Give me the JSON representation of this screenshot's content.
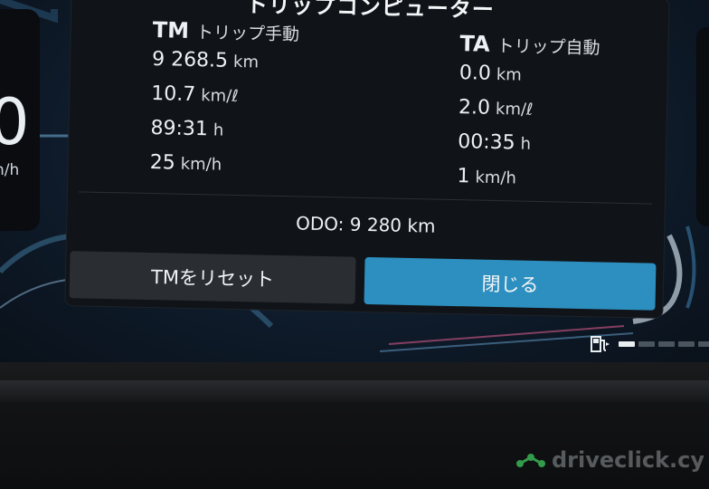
{
  "dialog": {
    "title": "トリップコンピューター",
    "tm": {
      "code": "TM",
      "label": "トリップ手動",
      "rows": [
        {
          "value": "9 268.5",
          "unit": "km"
        },
        {
          "value": "10.7",
          "unit": "km/ℓ"
        },
        {
          "value": "89:31",
          "unit": "h"
        },
        {
          "value": "25",
          "unit": "km/h"
        }
      ]
    },
    "ta": {
      "code": "TA",
      "label": "トリップ自動",
      "rows": [
        {
          "value": "0.0",
          "unit": "km"
        },
        {
          "value": "2.0",
          "unit": "km/ℓ"
        },
        {
          "value": "00:35",
          "unit": "h"
        },
        {
          "value": "1",
          "unit": "km/h"
        }
      ]
    },
    "odo": "ODO:  9 280 km",
    "buttons": {
      "reset": "TMをリセット",
      "close": "閉じる"
    }
  },
  "cluster": {
    "speed_fragment": "0",
    "speed_unit_fragment": "n/h",
    "fuel_icon": "fuel-pump-icon",
    "fuel_level": 0.2
  },
  "watermark": {
    "text": "driveclick.cy",
    "color": "#3bbf5a"
  }
}
